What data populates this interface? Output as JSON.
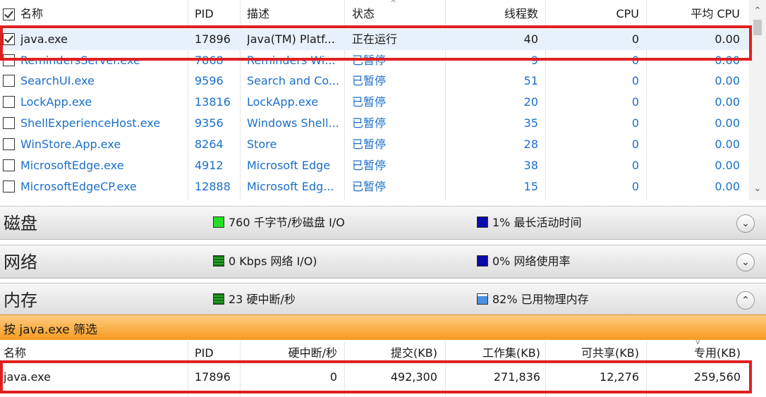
{
  "process_table": {
    "columns": {
      "name": "名称",
      "pid": "PID",
      "desc": "描述",
      "status": "状态",
      "threads": "线程数",
      "cpu": "CPU",
      "avg_cpu": "平均 CPU"
    },
    "rows": [
      {
        "name": "java.exe",
        "pid": "17896",
        "desc": "Java(TM) Platf...",
        "status": "正在运行",
        "threads": "40",
        "cpu": "0",
        "avg_cpu": "0.00",
        "checked": true,
        "selected": true,
        "suspended": false
      },
      {
        "name": "RemindersServer.exe",
        "pid": "7868",
        "desc": "Reminders Wi...",
        "status": "已暂停",
        "threads": "9",
        "cpu": "0",
        "avg_cpu": "0.00",
        "checked": false,
        "selected": false,
        "suspended": true
      },
      {
        "name": "SearchUI.exe",
        "pid": "9596",
        "desc": "Search and Co...",
        "status": "已暂停",
        "threads": "51",
        "cpu": "0",
        "avg_cpu": "0.00",
        "checked": false,
        "selected": false,
        "suspended": true
      },
      {
        "name": "LockApp.exe",
        "pid": "13816",
        "desc": "LockApp.exe",
        "status": "已暂停",
        "threads": "20",
        "cpu": "0",
        "avg_cpu": "0.00",
        "checked": false,
        "selected": false,
        "suspended": true
      },
      {
        "name": "ShellExperienceHost.exe",
        "pid": "9356",
        "desc": "Windows Shell...",
        "status": "已暂停",
        "threads": "35",
        "cpu": "0",
        "avg_cpu": "0.00",
        "checked": false,
        "selected": false,
        "suspended": true
      },
      {
        "name": "WinStore.App.exe",
        "pid": "8264",
        "desc": "Store",
        "status": "已暂停",
        "threads": "28",
        "cpu": "0",
        "avg_cpu": "0.00",
        "checked": false,
        "selected": false,
        "suspended": true
      },
      {
        "name": "MicrosoftEdge.exe",
        "pid": "4912",
        "desc": "Microsoft Edge",
        "status": "已暂停",
        "threads": "38",
        "cpu": "0",
        "avg_cpu": "0.00",
        "checked": false,
        "selected": false,
        "suspended": true
      },
      {
        "name": "MicrosoftEdgeCP.exe",
        "pid": "12888",
        "desc": "Microsoft Edg...",
        "status": "已暂停",
        "threads": "15",
        "cpu": "0",
        "avg_cpu": "0.00",
        "checked": false,
        "selected": false,
        "suspended": true
      }
    ]
  },
  "sections": [
    {
      "title": "磁盘",
      "ind1": "760 千字节/秒磁盘 I/O",
      "ind1_swatch": "green",
      "ind2": "1% 最长活动时间",
      "ind2_swatch": "navy",
      "expanded": false
    },
    {
      "title": "网络",
      "ind1": "0 Kbps 网络 I/O)",
      "ind1_swatch": "darkgreen",
      "ind2": "0% 网络使用率",
      "ind2_swatch": "navy",
      "expanded": false
    },
    {
      "title": "内存",
      "ind1": "23 硬中断/秒",
      "ind1_swatch": "darkgreen",
      "ind2": "82% 已用物理内存",
      "ind2_swatch": "lightblue",
      "expanded": true
    }
  ],
  "filter_label": "按 java.exe 筛选",
  "memory_table": {
    "columns": {
      "name": "名称",
      "pid": "PID",
      "hard_faults": "硬中断/秒",
      "commit": "提交(KB)",
      "working_set": "工作集(KB)",
      "shareable": "可共享(KB)",
      "private": "专用(KB)"
    },
    "row": {
      "name": "java.exe",
      "pid": "17896",
      "hard_faults": "0",
      "commit": "492,300",
      "working_set": "271,836",
      "shareable": "12,276",
      "private": "259,560"
    }
  },
  "colors": {
    "link_blue": "#1a6fc9",
    "highlight_red": "#e02020",
    "filter_orange": "#f79a1e"
  }
}
